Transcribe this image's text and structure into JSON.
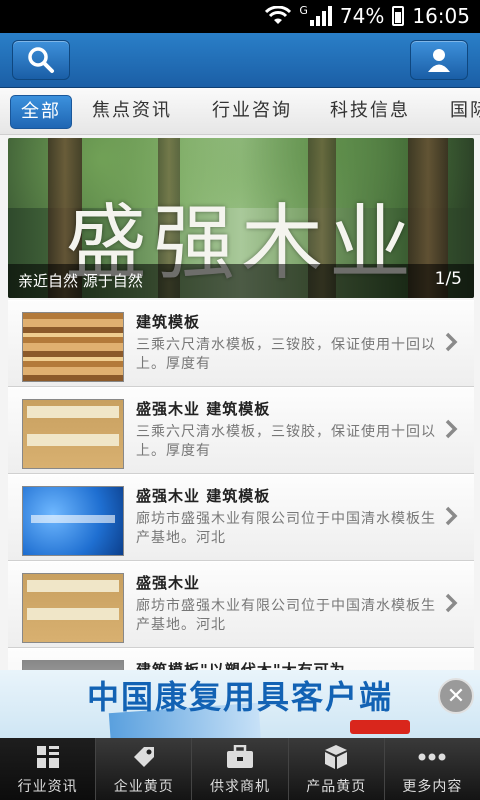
{
  "status_bar": {
    "network_type": "G",
    "battery": "74%",
    "time": "16:05"
  },
  "header": {
    "search_icon": "search-icon",
    "user_icon": "user-icon"
  },
  "tabs": [
    {
      "label": "全部",
      "active": true
    },
    {
      "label": "焦点资讯",
      "active": false
    },
    {
      "label": "行业咨询",
      "active": false
    },
    {
      "label": "科技信息",
      "active": false
    },
    {
      "label": "国际",
      "active": false
    }
  ],
  "banner": {
    "title": "盛强木业",
    "caption": "亲近自然 源于自然",
    "pager": "1/5"
  },
  "list": [
    {
      "title": "建筑模板",
      "desc": "三乘六尺清水模板，三铵胶，保证使用十回以上。厚度有",
      "thumb": "board"
    },
    {
      "title": "盛强木业 建筑模板",
      "desc": "三乘六尺清水模板，三铵胶，保证使用十回以上。厚度有",
      "thumb": "board2"
    },
    {
      "title": "盛强木业 建筑模板",
      "desc": "廊坊市盛强木业有限公司位于中国清水模板生产基地。河北",
      "thumb": "blue"
    },
    {
      "title": "盛强木业",
      "desc": "廊坊市盛强木业有限公司位于中国清水模板生产基地。河北",
      "thumb": "board2"
    },
    {
      "title": "建筑模板\"以塑代木\"大有可为",
      "desc": "",
      "thumb": "gray"
    }
  ],
  "ad": {
    "text": "中国康复用具客户端"
  },
  "bottom_nav": [
    {
      "label": "行业资讯",
      "icon": "grid-icon"
    },
    {
      "label": "企业黄页",
      "icon": "tag-icon"
    },
    {
      "label": "供求商机",
      "icon": "briefcase-icon"
    },
    {
      "label": "产品黄页",
      "icon": "box-icon"
    },
    {
      "label": "更多内容",
      "icon": "more-icon"
    }
  ],
  "colors": {
    "header_blue": "#1f66b3",
    "nav_dark": "#141414"
  }
}
